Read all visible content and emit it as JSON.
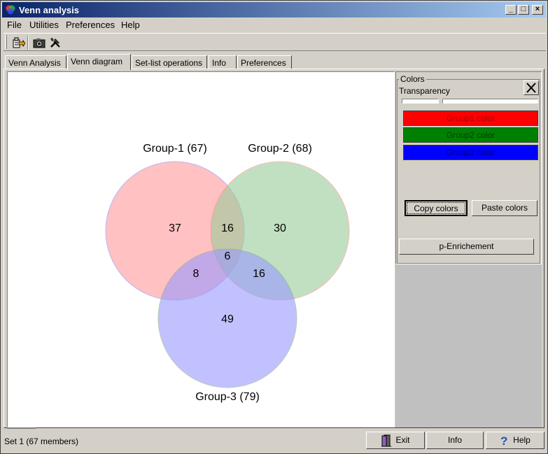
{
  "window": {
    "title": "Venn analysis"
  },
  "menu": {
    "items": [
      "File",
      "Utilities",
      "Preferences",
      "Help"
    ]
  },
  "tabs": [
    "Venn Analysis",
    "Venn diagram",
    "Set-list operations",
    "Info",
    "Preferences"
  ],
  "venn": {
    "groups": [
      {
        "label": "Group-1 (67)",
        "color": "#ff9999"
      },
      {
        "label": "Group-2 (68)",
        "color": "#99cc99"
      },
      {
        "label": "Group-3 (79)",
        "color": "#9999ff"
      }
    ],
    "regions": {
      "only1": "37",
      "only2": "30",
      "only3": "49",
      "g1g2": "16",
      "g1g3": "8",
      "g2g3": "16",
      "all": "6"
    }
  },
  "colors_panel": {
    "title": "Colors",
    "transparency_label": "Transparency",
    "group1_btn": "Group1 color",
    "group2_btn": "Group2 color",
    "group3_btn": "Group3 color",
    "group1_color": "#ff0000",
    "group2_color": "#008000",
    "group3_color": "#0000ff",
    "copy_colors": "Copy colors",
    "paste_colors": "Paste colors",
    "enrichment": "p-Enrichement"
  },
  "status": {
    "text": "Set 1 (67 members)",
    "exit": "Exit",
    "info": "Info",
    "help": "Help"
  }
}
